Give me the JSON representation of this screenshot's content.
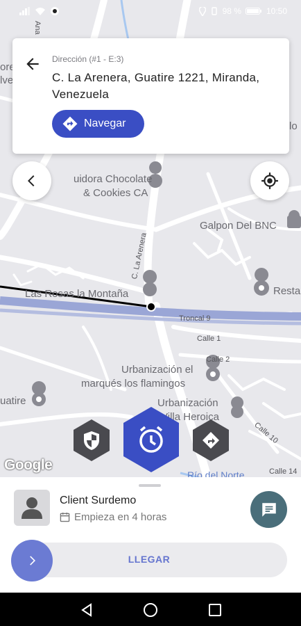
{
  "status_bar": {
    "battery_percent": "98 %",
    "time": "10:50"
  },
  "map": {
    "labels": {
      "cut_top_left_1": "ore",
      "cut_top_left_2": "lve",
      "cut_top_right": "lo",
      "poi_chocolate_1": "uidora Chocolate",
      "poi_chocolate_2": "& Cookies CA",
      "poi_galpon": "Galpon Del BNC",
      "poi_restaurant": "Resta",
      "poi_rosas": "Las Rosas la Montaña",
      "street_la_arenera": "C. La Arenera",
      "street_troncal": "Troncal 9",
      "street_calle1": "Calle 1",
      "street_calle2": "Calle 2",
      "street_calle10": "Calle 10",
      "street_calle14": "Calle 14",
      "urb_marques_1": "Urbanización el",
      "urb_marques_2": "marqués los flamingos",
      "urb_villa_1": "Urbanización",
      "urb_villa_2": "Villa Heroica",
      "left_uatire": "uatire",
      "rio": "Río del Norte",
      "top_vertical": "Ana"
    },
    "google_logo": "Google"
  },
  "destination_card": {
    "subtitle": "Dirección (#1 - E:3)",
    "address": "C. La Arenera, Guatire 1221, Miranda, Venezuela",
    "navigate_label": "Navegar"
  },
  "bottom_sheet": {
    "client_name": "Client Surdemo",
    "starts_text": "Empieza en 4 horas",
    "arrive_label": "LLEGAR"
  },
  "colors": {
    "accent_blue": "#3a4ec4",
    "hex_dark": "#4a4a4f",
    "chat_button": "#4a6e7a",
    "slider_knob": "#6b7bd3"
  },
  "icons": [
    "signal-icon",
    "wifi-icon",
    "app-icon",
    "location-icon",
    "vibrate-icon",
    "battery-icon",
    "back-arrow-icon",
    "directions-icon",
    "chevron-left-icon",
    "my-location-icon",
    "shield-icon",
    "alarm-clock-icon",
    "direction-turn-icon",
    "person-icon",
    "calendar-icon",
    "chat-icon",
    "chevron-right-icon",
    "nav-back-icon",
    "nav-home-icon",
    "nav-recents-icon"
  ]
}
